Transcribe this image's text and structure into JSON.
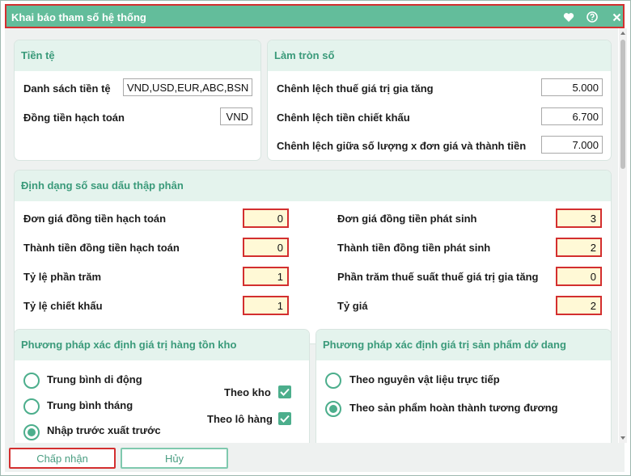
{
  "dialog": {
    "title": "Khai báo tham số hệ thống"
  },
  "currency": {
    "title": "Tiền tệ",
    "list_label": "Danh sách tiền tệ",
    "list_value": "VND,USD,EUR,ABC,BSN",
    "accounting_label": "Đồng tiền hạch toán",
    "accounting_value": "VND"
  },
  "rounding": {
    "title": "Làm tròn số",
    "vat_label": "Chênh lệch thuế giá trị gia tăng",
    "vat_value": "5.000",
    "discount_label": "Chênh lệch tiền chiết khấu",
    "discount_value": "6.700",
    "qty_label": "Chênh lệch giữa số lượng x đơn giá và thành tiền",
    "qty_value": "7.000"
  },
  "decimal": {
    "title": "Định dạng số sau dấu thập phân",
    "left": [
      {
        "label": "Đơn giá đồng tiền hạch toán",
        "value": "0"
      },
      {
        "label": "Thành tiền đồng tiền hạch toán",
        "value": "0"
      },
      {
        "label": "Tỷ lệ phần trăm",
        "value": "1"
      },
      {
        "label": "Tỷ lệ chiết khấu",
        "value": "1"
      }
    ],
    "right": [
      {
        "label": "Đơn giá đồng tiền phát sinh",
        "value": "3"
      },
      {
        "label": "Thành tiền đồng tiền phát sinh",
        "value": "2"
      },
      {
        "label": "Phần trăm thuế suất thuế giá trị gia tăng",
        "value": "0"
      },
      {
        "label": "Tỷ giá",
        "value": "2"
      }
    ]
  },
  "inventory": {
    "title": "Phương pháp xác định giá trị hàng tồn kho",
    "options": [
      {
        "label": "Trung bình di động",
        "checked": false
      },
      {
        "label": "Trung bình tháng",
        "checked": false
      },
      {
        "label": "Nhập trước xuất trước",
        "checked": true
      }
    ],
    "by_warehouse_label": "Theo kho",
    "by_warehouse_checked": true,
    "by_lot_label": "Theo lô hàng",
    "by_lot_checked": true
  },
  "wip": {
    "title": "Phương pháp xác định giá trị sản phẩm dở dang",
    "options": [
      {
        "label": "Theo nguyên vật liệu trực tiếp",
        "checked": false
      },
      {
        "label": "Theo sản phẩm hoàn thành tương đương",
        "checked": true
      }
    ]
  },
  "footer": {
    "accept_label": "Chấp nhận",
    "cancel_label": "Hủy"
  },
  "colors": {
    "accent": "#63bd9b",
    "highlight_border": "#d32f2f",
    "number_fill": "#fff9d6"
  }
}
